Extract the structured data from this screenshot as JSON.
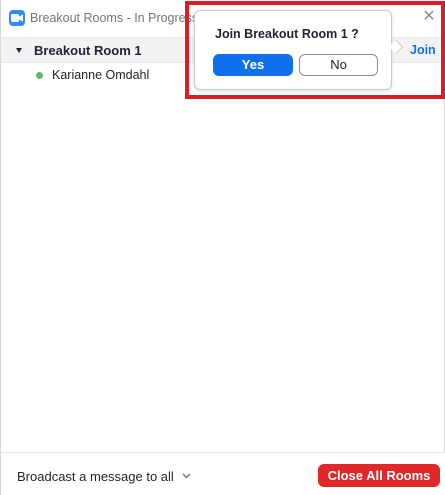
{
  "window": {
    "title": "Breakout Rooms - In Progress",
    "close_glyph": "✕"
  },
  "rooms": [
    {
      "name": "Breakout Room 1",
      "join_label": "Join",
      "participants": [
        {
          "name": "Karianne Omdahl",
          "status_color": "#5dba6c"
        }
      ]
    }
  ],
  "popup": {
    "title": "Join Breakout Room 1 ?",
    "yes_label": "Yes",
    "no_label": "No"
  },
  "footer": {
    "broadcast_label": "Broadcast a message to all",
    "close_all_label": "Close All Rooms"
  },
  "colors": {
    "accent": "#0e71eb",
    "danger": "#e02828",
    "highlight": "#e01b24"
  },
  "icons": {
    "app": "zoom-camera-icon",
    "caret": "caret-down-icon",
    "chevron": "chevron-down-icon",
    "close": "close-icon"
  }
}
